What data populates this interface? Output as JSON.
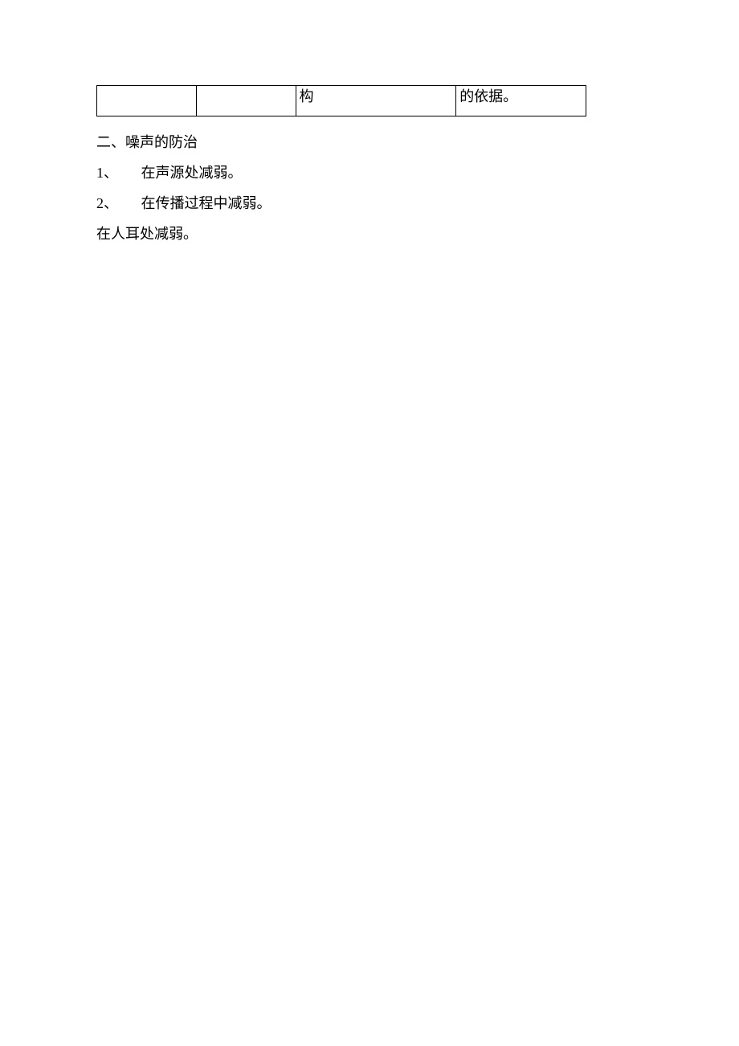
{
  "table": {
    "row": {
      "cell1": "",
      "cell2": "",
      "cell3": "构",
      "cell4": "的依据。"
    }
  },
  "content": {
    "heading": "二、噪声的防治",
    "item1_num": "1、",
    "item1_text": "在声源处减弱。",
    "item2_num": "2、",
    "item2_text": "在传播过程中减弱。",
    "item3": "在人耳处减弱。"
  }
}
